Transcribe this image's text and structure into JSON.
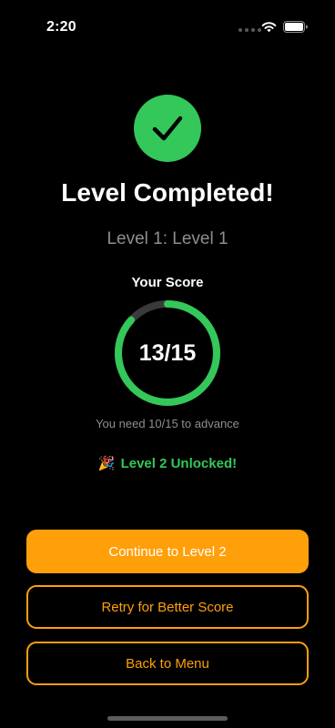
{
  "status_bar": {
    "time": "2:20",
    "icons": [
      "signal-dots-icon",
      "wifi-icon",
      "battery-icon"
    ]
  },
  "result": {
    "icon": "checkmark-icon",
    "title": "Level Completed!",
    "subtitle": "Level 1: Level 1"
  },
  "score": {
    "label": "Your Score",
    "value_text": "13/15",
    "correct": 13,
    "total": 15,
    "requirement_text": "You need 10/15 to advance"
  },
  "unlock": {
    "emoji": "🎉",
    "text": "Level 2 Unlocked!"
  },
  "actions": {
    "continue_label": "Continue to Level 2",
    "retry_label": "Retry for Better Score",
    "menu_label": "Back to Menu"
  },
  "colors": {
    "background": "#000000",
    "success": "#34c759",
    "accent": "#ff9f0a",
    "secondary_text": "#8e8e93",
    "ring_track": "#3a3a3c"
  }
}
